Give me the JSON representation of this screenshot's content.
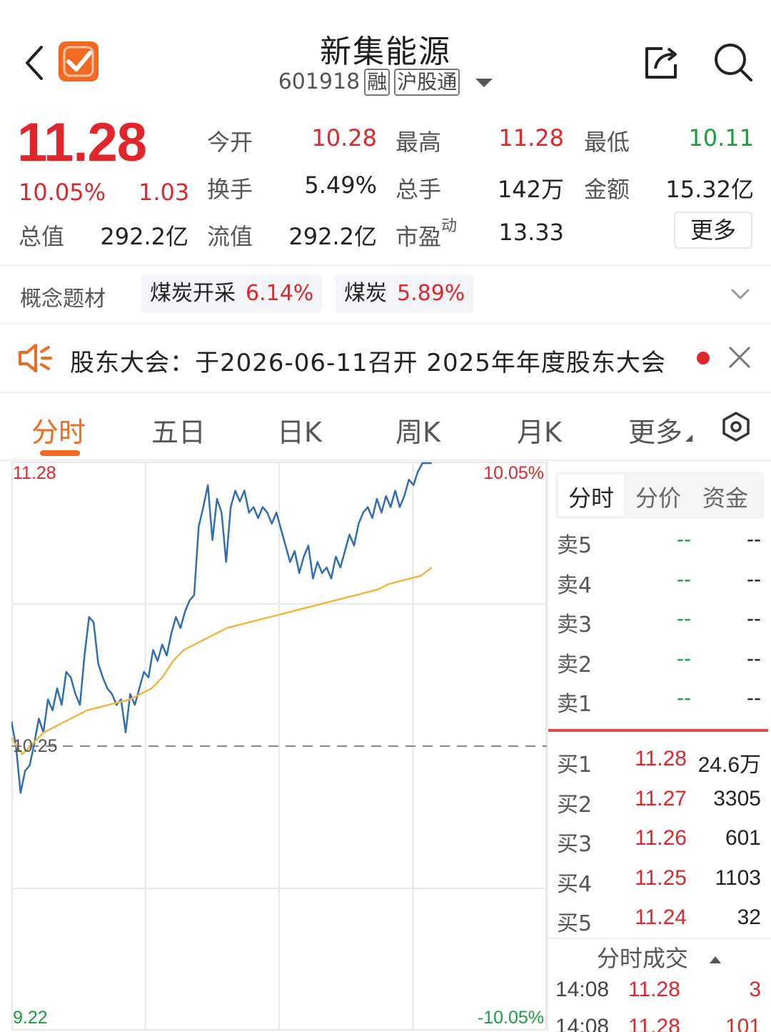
{
  "header": {
    "title": "新集能源",
    "code": "601918",
    "tags": [
      "融",
      "沪股通"
    ]
  },
  "quote": {
    "price": "11.28",
    "change_pct": "10.05%",
    "change_abs": "1.03",
    "stats": [
      {
        "label": "今开",
        "value": "10.28",
        "color": "red"
      },
      {
        "label": "最高",
        "value": "11.28",
        "color": "red"
      },
      {
        "label": "最低",
        "value": "10.11",
        "color": "green"
      },
      {
        "label": "换手",
        "value": "5.49%",
        "color": "dark"
      },
      {
        "label": "总手",
        "value": "142万",
        "color": "dark"
      },
      {
        "label": "金额",
        "value": "15.32亿",
        "color": "dark"
      },
      {
        "label": "总值",
        "value": "292.2亿",
        "color": "dark"
      },
      {
        "label": "流值",
        "value": "292.2亿",
        "color": "dark"
      },
      {
        "label": "市盈",
        "sup": "动",
        "value": "13.33",
        "color": "dark"
      }
    ],
    "more_label": "更多"
  },
  "concepts": {
    "label": "概念题材",
    "items": [
      {
        "name": "煤炭开采",
        "pct": "6.14%"
      },
      {
        "name": "煤炭",
        "pct": "5.89%"
      }
    ]
  },
  "notice": {
    "text": "股东大会：于2026-06-11召开 2025年年度股东大会"
  },
  "tabs": [
    "分时",
    "五日",
    "日K",
    "周K",
    "月K",
    "更多"
  ],
  "chart_axes": {
    "top_price": "11.28",
    "top_pct": "10.05%",
    "ref_price": "10.25",
    "bottom_price": "9.22",
    "bottom_pct": "-10.05%"
  },
  "chart_data": {
    "type": "line",
    "title": "",
    "xlabel": "",
    "ylabel": "",
    "ylim": [
      9.22,
      11.28
    ],
    "reference": 10.25,
    "x_sessions": 4,
    "x_end_fraction": 0.785,
    "series": [
      {
        "values": [
          10.34,
          10.25,
          10.08,
          10.16,
          10.18,
          10.26,
          10.35,
          10.3,
          10.42,
          10.38,
          10.46,
          10.4,
          10.52,
          10.5,
          10.44,
          10.4,
          10.58,
          10.72,
          10.7,
          10.55,
          10.5,
          10.46,
          10.44,
          10.4,
          10.42,
          10.3,
          10.44,
          10.4,
          10.46,
          10.52,
          10.5,
          10.6,
          10.56,
          10.62,
          10.58,
          10.66,
          10.72,
          10.68,
          10.74,
          10.78,
          10.8,
          11.05,
          11.12,
          11.2,
          11.0,
          11.15,
          11.1,
          10.92,
          11.12,
          11.18,
          11.14,
          11.18,
          11.1,
          11.12,
          11.08,
          11.12,
          11.1,
          11.06,
          11.1,
          11.04,
          10.98,
          10.92,
          10.96,
          10.88,
          10.94,
          10.98,
          10.86,
          10.92,
          10.88,
          10.9,
          10.86,
          10.94,
          10.9,
          10.96,
          11.02,
          10.98,
          11.06,
          11.1,
          11.12,
          11.08,
          11.15,
          11.1,
          11.16,
          11.12,
          11.18,
          11.12,
          11.16,
          11.22,
          11.2,
          11.25,
          11.28,
          11.28,
          11.28
        ]
      },
      {
        "values": [
          10.28,
          10.22,
          10.26,
          10.3,
          10.32,
          10.34,
          10.36,
          10.38,
          10.39,
          10.4,
          10.41,
          10.42,
          10.44,
          10.46,
          10.5,
          10.56,
          10.6,
          10.62,
          10.64,
          10.66,
          10.68,
          10.69,
          10.7,
          10.71,
          10.72,
          10.73,
          10.74,
          10.75,
          10.76,
          10.77,
          10.78,
          10.79,
          10.8,
          10.81,
          10.82,
          10.84,
          10.85,
          10.86,
          10.87,
          10.9
        ]
      }
    ]
  },
  "orderbook": {
    "tabs": [
      "分时",
      "分价",
      "资金"
    ],
    "asks": [
      {
        "label": "卖5",
        "price": "--",
        "vol": "--"
      },
      {
        "label": "卖4",
        "price": "--",
        "vol": "--"
      },
      {
        "label": "卖3",
        "price": "--",
        "vol": "--"
      },
      {
        "label": "卖2",
        "price": "--",
        "vol": "--"
      },
      {
        "label": "卖1",
        "price": "--",
        "vol": "--"
      }
    ],
    "bids": [
      {
        "label": "买1",
        "price": "11.28",
        "vol": "24.6万"
      },
      {
        "label": "买2",
        "price": "11.27",
        "vol": "3305"
      },
      {
        "label": "买3",
        "price": "11.26",
        "vol": "601"
      },
      {
        "label": "买4",
        "price": "11.25",
        "vol": "1103"
      },
      {
        "label": "买5",
        "price": "11.24",
        "vol": "32"
      }
    ]
  },
  "trades": {
    "title": "分时成交",
    "rows": [
      {
        "time": "14:08",
        "price": "11.28",
        "vol": "3",
        "vol_color": "red"
      },
      {
        "time": "14:08",
        "price": "11.28",
        "vol": "101",
        "vol_color": "red"
      }
    ]
  },
  "colors": {
    "up": "#e0262b",
    "down": "#16a03a",
    "accent": "#f06a1f",
    "price_line": "#2f6db5",
    "avg_line": "#f2b640"
  }
}
